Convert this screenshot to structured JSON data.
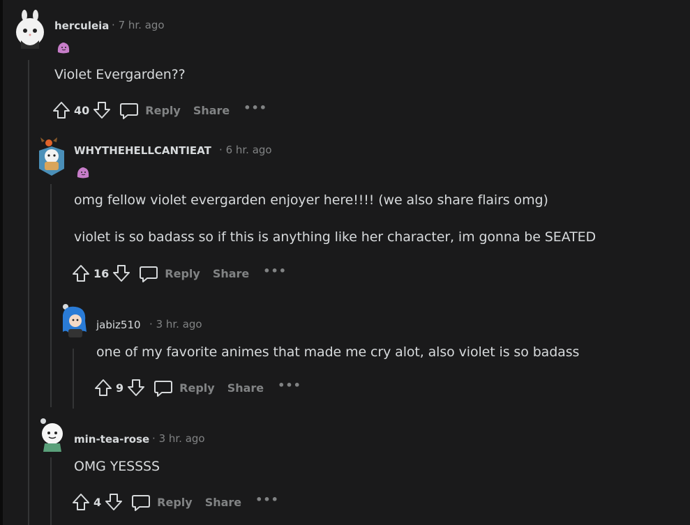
{
  "comments": [
    {
      "username": "herculeia",
      "time": "7 hr. ago",
      "flair": "ditto-emoji",
      "body": [
        "Violet Evergarden??"
      ],
      "score": "40",
      "reply_label": "Reply",
      "share_label": "Share",
      "more_label": "•••"
    },
    {
      "username": "WHYTHEHELLCANTIEAT",
      "time": "6 hr. ago",
      "flair": "ditto-emoji",
      "body": [
        "omg fellow violet evergarden enjoyer here!!!! (we also share flairs omg)",
        "violet is so badass so if this is anything like her character, im gonna be SEATED"
      ],
      "score": "16",
      "reply_label": "Reply",
      "share_label": "Share",
      "more_label": "•••"
    },
    {
      "username": "jabiz510",
      "time": "3 hr. ago",
      "body": [
        "one of my favorite animes that made me cry alot, also violet is so badass"
      ],
      "score": "9",
      "reply_label": "Reply",
      "share_label": "Share",
      "more_label": "•••"
    },
    {
      "username": "min-tea-rose",
      "time": "3 hr. ago",
      "body": [
        "OMG YESSSS"
      ],
      "score": "4",
      "reply_label": "Reply",
      "share_label": "Share",
      "more_label": "•••"
    }
  ],
  "separator": "·",
  "colors": {
    "background": "#1a1a1b",
    "text": "#d7dadc",
    "muted": "#818384",
    "thread_line": "#343536",
    "flair_pink": "#c77dc9"
  },
  "icons": [
    "upvote-icon",
    "downvote-icon",
    "reply-icon",
    "more-icon"
  ]
}
